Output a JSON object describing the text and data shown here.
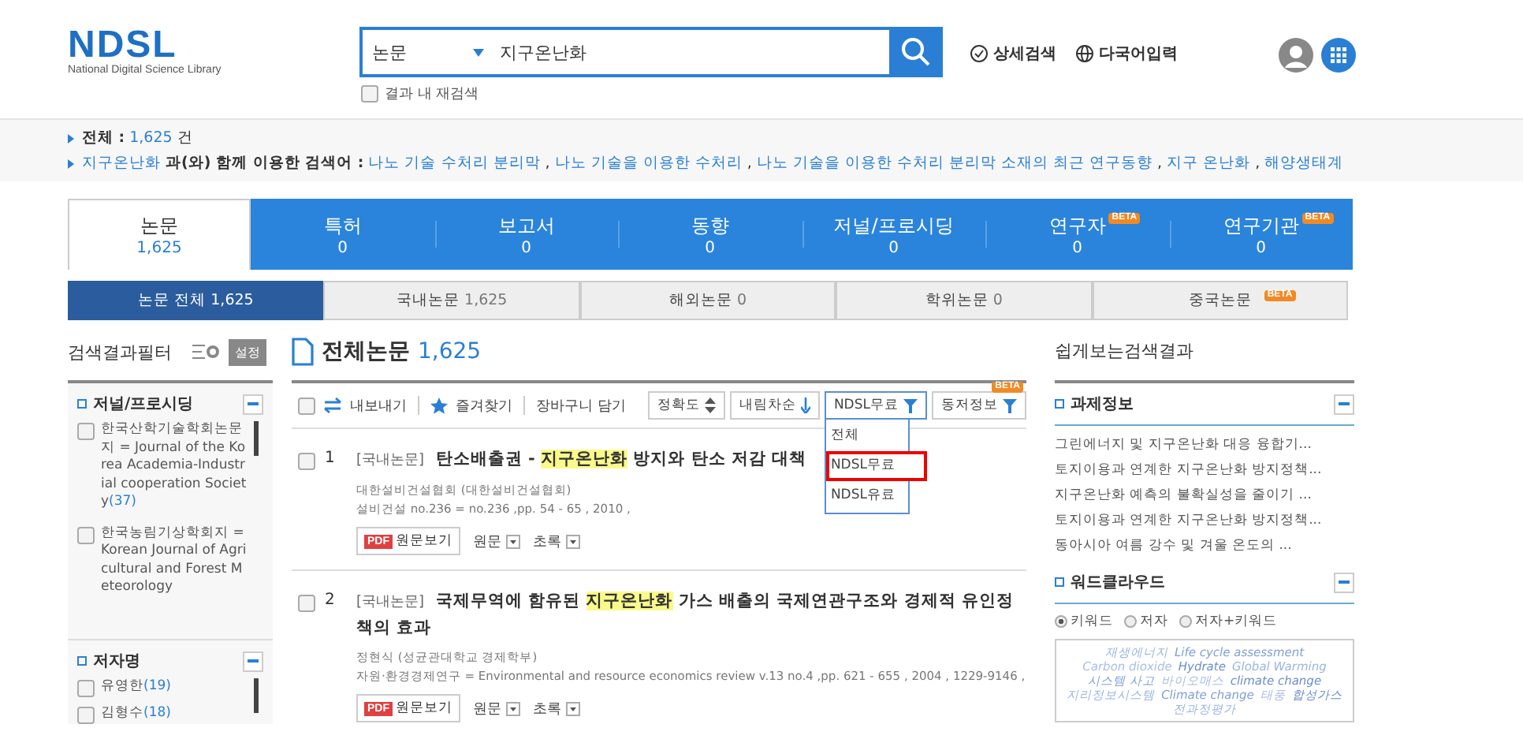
{
  "header": {
    "logo": {
      "title": "NDSL",
      "subtitle": "National Digital Science Library"
    },
    "search": {
      "category": "논문",
      "value": "지구온난화"
    },
    "research_checkbox": {
      "label": "결과 내 재검색",
      "checked": false
    },
    "links": [
      {
        "label": "상세검색",
        "kind": "detail"
      },
      {
        "label": "다국어입력",
        "kind": "globe"
      }
    ]
  },
  "summary": {
    "total_label": "전체 :",
    "total_value": "1,625",
    "total_unit": "건",
    "related_keyword": "지구온난화",
    "related_label": "과(와) 함께 이용한 검색어 :",
    "separator": ",",
    "related_terms": [
      "나노 기술 수처리 분리막",
      "나노 기술을 이용한 수처리",
      "나노 기술을 이용한 수처리 분리막 소재의 최근 연구동향",
      "지구 온난화",
      "해양생태계"
    ]
  },
  "tabs": [
    {
      "label": "논문",
      "count": "1,625",
      "selected": true
    },
    {
      "label": "특허",
      "count": "0",
      "selected": false
    },
    {
      "label": "보고서",
      "count": "0",
      "selected": false
    },
    {
      "label": "동향",
      "count": "0",
      "selected": false
    },
    {
      "label": "저널/프로시딩",
      "count": "0",
      "selected": false
    },
    {
      "label": "연구자",
      "count": "0",
      "selected": false,
      "badge": "BETA"
    },
    {
      "label": "연구기관",
      "count": "0",
      "selected": false,
      "badge": "BETA"
    }
  ],
  "subtabs": [
    {
      "label": "논문 전체",
      "count": "1,625",
      "selected": true
    },
    {
      "label": "국내논문",
      "count": "1,625",
      "selected": false
    },
    {
      "label": "해외논문",
      "count": "0",
      "selected": false
    },
    {
      "label": "학위논문",
      "count": "0",
      "selected": false
    },
    {
      "label": "중국논문",
      "selected": false,
      "badge": "BETA"
    }
  ],
  "filter": {
    "title": "검색결과필터",
    "button": "설정",
    "sections": [
      {
        "title": "저널/프로시딩",
        "items": [
          {
            "label": "한국산학기술학회논문지 = Journal of the Korea Academia-Industrial cooperation Society",
            "count": "(37)",
            "checked": false
          },
          {
            "label": "한국농림기상학회지 = Korean Journal of Agricultural and Forest Meteorology",
            "checked": false
          }
        ]
      },
      {
        "title": "저자명",
        "items": [
          {
            "label": "유영한",
            "count": "(19)",
            "checked": false
          },
          {
            "label": "김형수",
            "count": "(18)",
            "checked": false
          }
        ]
      }
    ]
  },
  "main": {
    "title": "전체논문",
    "count": "1,625",
    "select_all": {
      "checked": false
    },
    "tools": [
      {
        "label": "내보내기",
        "kind": "export"
      },
      {
        "label": "즐겨찾기",
        "kind": "star"
      },
      {
        "label": "장바구니 담기",
        "kind": "plain"
      }
    ],
    "sorts": [
      {
        "label": "정확도",
        "kind": "sort",
        "open": false
      },
      {
        "label": "내림차순",
        "kind": "order",
        "open": false
      },
      {
        "label": "NDSL무료",
        "kind": "filter",
        "open": true
      },
      {
        "label": "동저정보",
        "kind": "filter",
        "open": false,
        "badge": "BETA"
      }
    ],
    "dropdown": [
      {
        "label": "전체",
        "marked": false
      },
      {
        "label": "NDSL무료",
        "marked": true
      },
      {
        "label": "NDSL유료",
        "marked": false
      }
    ],
    "results": [
      {
        "number": "1",
        "checked": false,
        "type": "[국내논문]",
        "title_before": "탄소배출권 - ",
        "keyword": "지구온난화",
        "title_after": " 방지와 탄소 저감 대책",
        "publisher": "대한설비건설협회 (대한설비건설협회)",
        "source": "설비건설 no.236 = no.236 ,pp. 54 - 65 , 2010 ,",
        "pdf": "PDF",
        "view": "원문보기",
        "menus": [
          "원문",
          "초록"
        ]
      },
      {
        "number": "2",
        "checked": false,
        "type": "[국내논문]",
        "title_before": "국제무역에 함유된 ",
        "keyword": "지구온난화",
        "title_after": " 가스 배출의 국제연관구조와 경제적 유인정책의 효과",
        "publisher": "정현식 (성균관대학교 경제학부)",
        "source": "자원·환경경제연구 = Environmental and resource economics review v.13 no.4 ,pp. 621 - 655 , 2004 , 1229-9146 ,",
        "pdf": "PDF",
        "view": "원문보기",
        "menus": [
          "원문",
          "초록"
        ]
      }
    ]
  },
  "right": {
    "title": "쉽게보는검색결과",
    "projects": {
      "title": "과제정보",
      "items": [
        "그린에너지 및 지구온난화 대응 융합기...",
        "토지이용과 연계한 지구온난화 방지정책...",
        "지구온난화 예측의 불확실성을 줄이기 ...",
        "토지이용과 연계한 지구온난화 방지정책...",
        "동아시아 여름 강수 및 겨울 온도의 ..."
      ]
    },
    "cloud": {
      "title": "워드클라우드",
      "options": [
        {
          "label": "키워드",
          "selected": true
        },
        {
          "label": "저자",
          "selected": false
        },
        {
          "label": "저자+키워드",
          "selected": false
        }
      ],
      "words": [
        "재생에너지",
        "Life cycle assessment",
        "Carbon dioxide",
        "Hydrate",
        "Global Warming",
        "시스템 사고",
        "바이오매스",
        "climate change",
        "지리정보시스템",
        "Climate change",
        "태풍",
        "합성가스",
        "전과정평가"
      ]
    }
  }
}
